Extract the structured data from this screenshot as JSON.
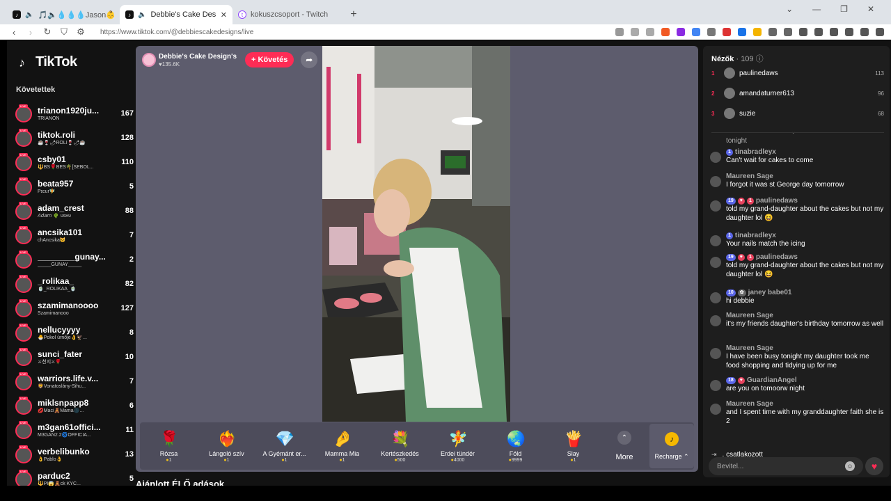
{
  "browser": {
    "tabs": [
      {
        "title": "🎵🔈💧💧💧Jason👶👶💧💧(@jason_sm",
        "icon": "tiktok-icon",
        "active": false
      },
      {
        "title": "Debbie's Cake Design's (@de",
        "icon": "tiktok-icon",
        "active": true
      },
      {
        "title": "kokuszcsoport - Twitch",
        "icon": "twitch-icon",
        "active": false
      }
    ],
    "new_tab": "+",
    "url": "https://www.tiktok.com/@debbiescakedesigns/live"
  },
  "sidebar": {
    "logo": "TikTok",
    "following_title": "Követettek",
    "items": [
      {
        "name": "trianon1920ju...",
        "sub": "TRIANON",
        "count": "167"
      },
      {
        "name": "tiktok.roli",
        "sub": "☕🍷🌶ROLI🍷🌶☕",
        "count": "128"
      },
      {
        "name": "csby01",
        "sub": "🔱BS🌹BES🌴[SEBOL...",
        "count": "110"
      },
      {
        "name": "beata957",
        "sub": "Pɪcur🧚",
        "count": "5"
      },
      {
        "name": "adam_crest",
        "sub": "𝘈𝘥𝘢𝘮 🌵 ᴜsʜᴜ",
        "count": "88"
      },
      {
        "name": "ancsika101",
        "sub": "сhAncsika😺",
        "count": "7"
      },
      {
        "name": "________gunay...",
        "sub": "_____GUNAY_____",
        "count": "2"
      },
      {
        "name": "_rolikaa_",
        "sub": "🍵_ROLIKAA_🍵",
        "count": "82"
      },
      {
        "name": "szamimanoooo",
        "sub": "Szamimanooo",
        "count": "127"
      },
      {
        "name": "nellucyyyy",
        "sub": "🐣Pokol úrnője👌🦅...",
        "count": "8"
      },
      {
        "name": "sunci_fater",
        "sub": "⚔천지⚔🌹",
        "count": "10"
      },
      {
        "name": "warriors.life.v...",
        "sub": "🦁Vonatoslány-Sihu...",
        "count": "7"
      },
      {
        "name": "miklsnpapp8",
        "sub": "💋Maci🧸Mama🌑...",
        "count": "6"
      },
      {
        "name": "m3gan61offici...",
        "sub": "M3GAN2.2🌀OFFICIA...",
        "count": "11"
      },
      {
        "name": "verbelibunko",
        "sub": "👌Pablo👌",
        "count": "13"
      },
      {
        "name": "parduc2",
        "sub": "🔱Pí😱🧸ck KYC...",
        "count": "5"
      }
    ]
  },
  "stream": {
    "host_name": "Debbie's Cake Design's",
    "host_likes": "♥135.6K",
    "follow_label": "+ Követés",
    "gifts": [
      {
        "icon": "🌹",
        "name": "Rózsa",
        "price": "1"
      },
      {
        "icon": "❤️‍🔥",
        "name": "Lángoló szív",
        "price": "1"
      },
      {
        "icon": "💎",
        "name": "A Gyémánt er...",
        "price": "1"
      },
      {
        "icon": "🤌",
        "name": "Mamma Mia",
        "price": "1"
      },
      {
        "icon": "💐",
        "name": "Kertészkedés",
        "price": "500"
      },
      {
        "icon": "🧚",
        "name": "Erdei tündér",
        "price": "4000"
      },
      {
        "icon": "🌏",
        "name": "Föld",
        "price": "9999"
      },
      {
        "icon": "🍟",
        "name": "Slay",
        "price": "1"
      }
    ],
    "more_label": "More",
    "recharge_label": "Recharge ⌃",
    "recommended_title": "Ajánlott ÉLŐ adások"
  },
  "chat": {
    "viewers_label": "Nézők",
    "viewers_count": "· 109",
    "top_viewers": [
      {
        "rank": "1",
        "name": "paulinedaws",
        "score": "113"
      },
      {
        "rank": "2",
        "name": "amandaturner613",
        "score": "96"
      },
      {
        "rank": "3",
        "name": "suzie",
        "score": "68"
      }
    ],
    "messages": [
      {
        "user": "",
        "text": "tonight",
        "badges": []
      },
      {
        "user": "tinabradleyx",
        "text": "Can't wait for cakes to come",
        "badges": [
          "1"
        ]
      },
      {
        "user": "Maureen Sage",
        "text": "I forgot it was st George day tomorrow",
        "badges": []
      },
      {
        "user": "paulinedaws",
        "text": "told my grand-daughter about the cakes but not my daughter lol 😆",
        "badges": [
          "19",
          "♥",
          "1"
        ]
      },
      {
        "user": "tinabradleyx",
        "text": "Your nails match the icing",
        "badges": [
          "1"
        ]
      },
      {
        "user": "paulinedaws",
        "text": "told my grand-daughter about the cakes but not my daughter lol 😆",
        "badges": [
          "19",
          "♥",
          "1"
        ]
      },
      {
        "user": "janey babe01",
        "text": "hi debbie",
        "badges": [
          "10",
          "✿"
        ]
      },
      {
        "user": "Maureen Sage",
        "text": "it's my friends daughter's birthday tomorrow as well",
        "badges": []
      },
      {
        "user": "Maureen Sage",
        "text": "I have been busy tonight my daughter took me food shopping and tidying up for me",
        "badges": []
      },
      {
        "user": "GuardianAngel",
        "text": "are you on tomoorw night",
        "badges": [
          "18",
          "♥"
        ]
      },
      {
        "user": "Maureen Sage",
        "text": "and I spent time with my granddaughter faith she is 2",
        "badges": []
      }
    ],
    "joined_text": ". csatlakozott",
    "input_placeholder": "Bevitel..."
  }
}
